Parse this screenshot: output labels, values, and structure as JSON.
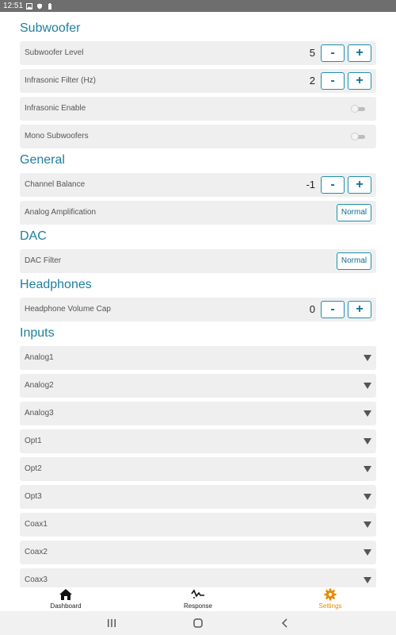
{
  "status_bar": {
    "time": "12:51"
  },
  "sections": {
    "subwoofer": {
      "title": "Subwoofer",
      "level_label": "Subwoofer Level",
      "level_value": "5",
      "infrasonic_filter_label": "Infrasonic Filter (Hz)",
      "infrasonic_filter_value": "2",
      "infrasonic_enable_label": "Infrasonic Enable",
      "mono_label": "Mono Subwoofers"
    },
    "general": {
      "title": "General",
      "balance_label": "Channel Balance",
      "balance_value": "-1",
      "analog_amp_label": "Analog Amplification",
      "analog_amp_value": "Normal"
    },
    "dac": {
      "title": "DAC",
      "filter_label": "DAC Filter",
      "filter_value": "Normal"
    },
    "headphones": {
      "title": "Headphones",
      "cap_label": "Headphone Volume Cap",
      "cap_value": "0"
    },
    "inputs": {
      "title": "Inputs",
      "items": [
        "Analog1",
        "Analog2",
        "Analog3",
        "Opt1",
        "Opt2",
        "Opt3",
        "Coax1",
        "Coax2",
        "Coax3"
      ]
    }
  },
  "stepper": {
    "minus": "-",
    "plus": "+"
  },
  "toggles": {
    "infrasonic_enable": false,
    "mono_subwoofers": false
  },
  "bottom_nav": {
    "items": [
      {
        "label": "Dashboard",
        "icon": "home-icon"
      },
      {
        "label": "Response",
        "icon": "waveform-icon"
      },
      {
        "label": "Settings",
        "icon": "gear-icon"
      }
    ],
    "active": "Settings"
  },
  "colors": {
    "accent": "#1e7f9e",
    "active_nav": "#e68a00",
    "row_bg": "#efefef"
  }
}
